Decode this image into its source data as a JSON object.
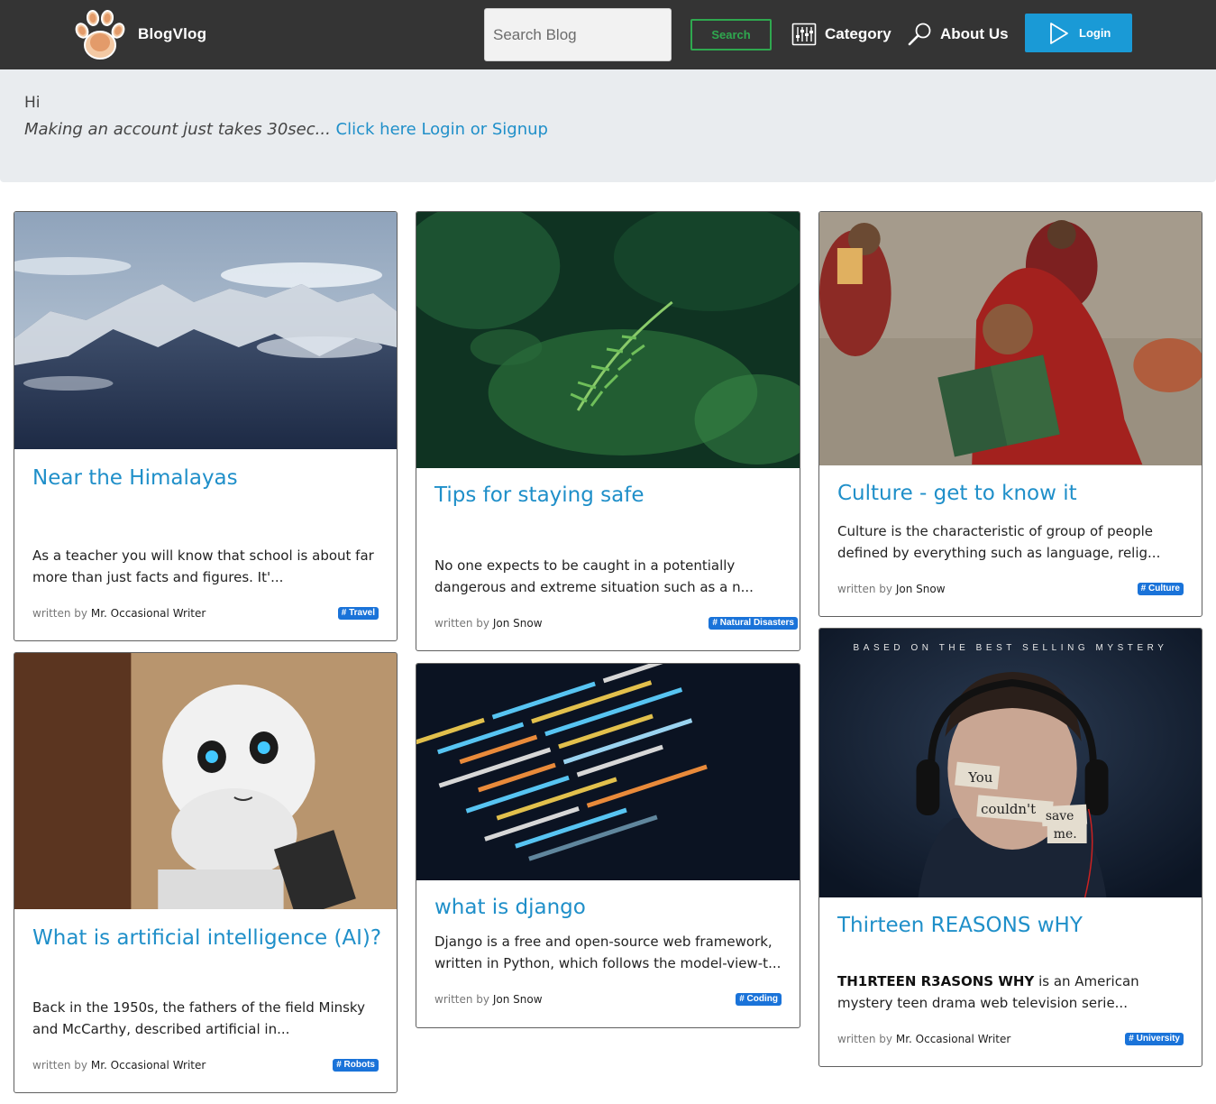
{
  "navbar": {
    "brand_name": "BlogVlog",
    "search_placeholder": "Search Blog",
    "search_button": "Search",
    "category_label": "Category",
    "about_label": "About Us",
    "login_label": "Login"
  },
  "greeting": {
    "hi": "Hi",
    "prompt": "Making an account just takes 30sec...",
    "link": "Click here Login or Signup"
  },
  "posts": [
    {
      "title": "Near the Himalayas",
      "excerpt": "As a teacher you will know that school is about far more than just facts and figures. It'...",
      "written_by": "written by",
      "author": "Mr. Occasional Writer",
      "tag": "# Travel"
    },
    {
      "title": "Tips for staying safe",
      "excerpt": "No one expects to be caught in a potentially dangerous and extreme situation such as a n...",
      "written_by": "written by",
      "author": "Jon Snow",
      "tag": "# Natural Disasters"
    },
    {
      "title": "Culture - get to know it",
      "excerpt": "Culture is the characteristic of group of people defined by everything such as language, relig...",
      "written_by": "written by",
      "author": "Jon Snow",
      "tag": "# Culture"
    },
    {
      "title": "What is artificial intelligence (AI)?",
      "excerpt": "Back in the 1950s, the fathers of the field Minsky and McCarthy, described artificial in...",
      "written_by": "written by",
      "author": "Mr. Occasional Writer",
      "tag": "# Robots"
    },
    {
      "title": "what is django",
      "excerpt": "Django is a free and open-source web framework, written in Python, which follows the model-view-t...",
      "written_by": "written by",
      "author": "Jon Snow",
      "tag": "# Coding"
    },
    {
      "title": "Thirteen REASONS wHY",
      "excerpt_bold": "TH1RTEEN R3ASONS WHY",
      "excerpt": " is an American mystery teen drama web television serie...",
      "written_by": "written by",
      "author": "Mr. Occasional Writer",
      "tag": "# University",
      "image_text": {
        "banner": "BASED ON THE BEST SELLING MYSTERY",
        "word1": "You",
        "word2": "couldn't",
        "word3": "save",
        "word4": "me."
      }
    }
  ],
  "colors": {
    "navbar_bg": "#343434",
    "accent_blue": "#1a9ad6",
    "link_blue": "#1f8fc9",
    "search_green": "#2fa84f",
    "tag_blue": "#1a73d9",
    "greeting_bg": "#e9ecef"
  },
  "icons": {
    "brand": "paw-print-icon",
    "category": "sliders-icon",
    "about": "magnifier-icon",
    "login": "play-triangle-icon"
  }
}
